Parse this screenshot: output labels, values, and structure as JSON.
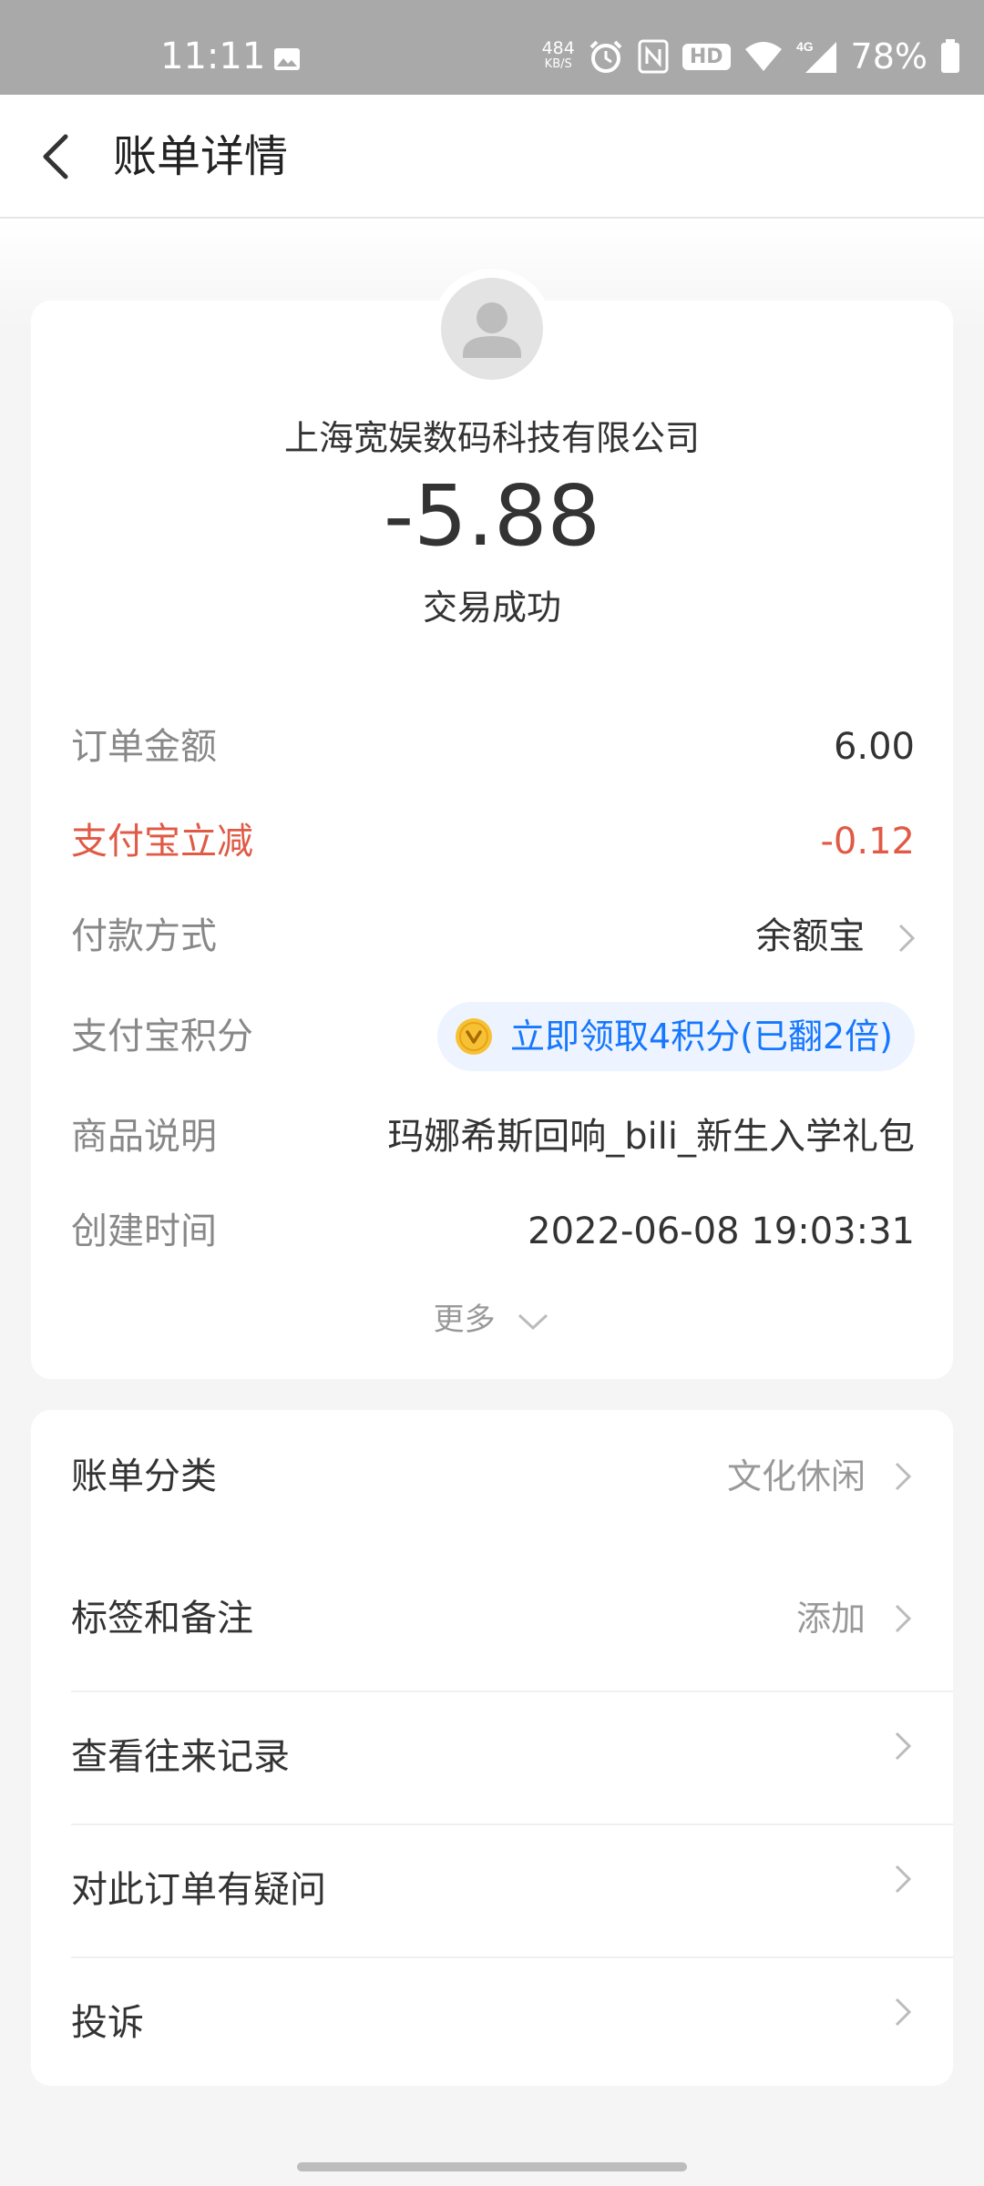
{
  "status_bar": {
    "time": "11:11",
    "net_speed": "484",
    "net_unit": "KB/S",
    "hd_label": "HD",
    "network": "4G",
    "battery": "78%"
  },
  "nav": {
    "title": "账单详情"
  },
  "bill": {
    "merchant": "上海宽娱数码科技有限公司",
    "amount": "-5.88",
    "status": "交易成功"
  },
  "details": {
    "order_amount": {
      "label": "订单金额",
      "value": "6.00"
    },
    "discount": {
      "label": "支付宝立减",
      "value": "-0.12"
    },
    "payment_method": {
      "label": "付款方式",
      "value": "余额宝"
    },
    "points": {
      "label": "支付宝积分",
      "value": "立即领取4积分(已翻2倍)"
    },
    "product": {
      "label": "商品说明",
      "value": "玛娜希斯回响_bili_新生入学礼包"
    },
    "created_time": {
      "label": "创建时间",
      "value": "2022-06-08 19:03:31"
    },
    "more_label": "更多"
  },
  "menu": {
    "category": {
      "label": "账单分类",
      "value": "文化休闲"
    },
    "tags": {
      "label": "标签和备注",
      "value": "添加"
    },
    "history": {
      "label": "查看往来记录"
    },
    "question": {
      "label": "对此订单有疑问"
    },
    "complaint": {
      "label": "投诉"
    }
  },
  "colors": {
    "accent_blue": "#1677ff",
    "discount_red": "#e05a45",
    "status_bar_bg": "#a9a9a9"
  }
}
